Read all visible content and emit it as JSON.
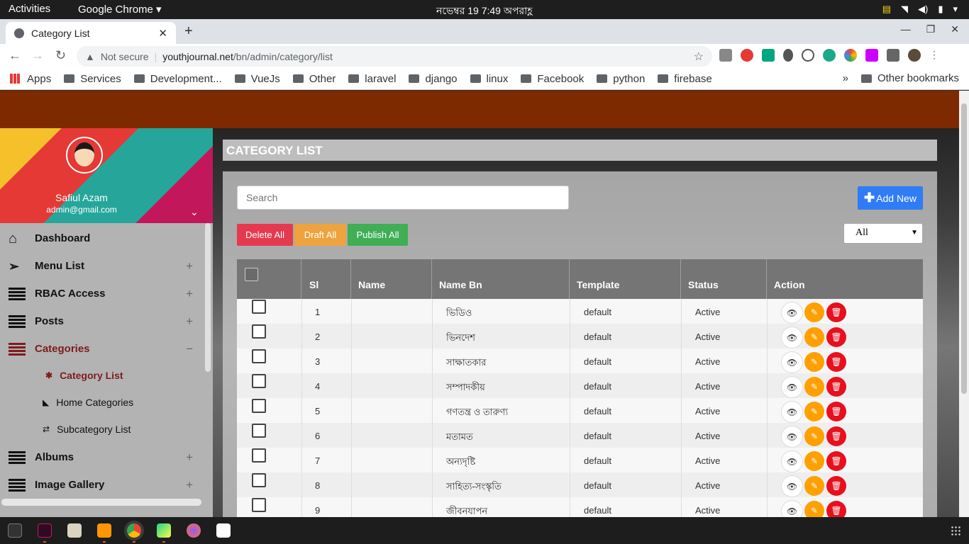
{
  "system": {
    "activities": "Activities",
    "app_menu": "Google Chrome",
    "clock": "নভেম্বর 19   7:49 অপরাহ্ণ"
  },
  "browser": {
    "tab_title": "Category List",
    "omnibox": {
      "security": "Not secure",
      "host": "youthjournal.net",
      "path": "/bn/admin/category/list"
    },
    "bookmarks": [
      "Apps",
      "Services",
      "Development...",
      "VueJs",
      "Other",
      "laravel",
      "django",
      "linux",
      "Facebook",
      "python",
      "firebase"
    ],
    "other_bookmarks": "Other bookmarks"
  },
  "sidebar": {
    "user_name": "Safiul Azam",
    "user_email": "admin@gmail.com",
    "menu": [
      {
        "label": "Dashboard",
        "icon": "home-icon"
      },
      {
        "label": "Menu List",
        "icon": "paper-plane-icon"
      },
      {
        "label": "RBAC Access",
        "icon": "bars-icon"
      },
      {
        "label": "Posts",
        "icon": "bars-icon"
      },
      {
        "label": "Categories",
        "icon": "bars-icon"
      },
      {
        "label": "Albums",
        "icon": "bars-icon"
      },
      {
        "label": "Image Gallery",
        "icon": "bars-icon"
      }
    ],
    "submenu": [
      {
        "label": "Category List",
        "icon": "asterisk-icon"
      },
      {
        "label": "Home Categories",
        "icon": "tag-icon"
      },
      {
        "label": "Subcategory List",
        "icon": "exchange-icon"
      }
    ]
  },
  "main": {
    "title": "CATEGORY LIST",
    "search_placeholder": "Search",
    "add_new": "Add New",
    "delete_all": "Delete All",
    "draft_all": "Draft All",
    "publish_all": "Publish All",
    "filter_selected": "All",
    "columns": [
      "Sl",
      "Name",
      "Name Bn",
      "Template",
      "Status",
      "Action"
    ],
    "rows": [
      {
        "sl": "1",
        "name": "",
        "name_bn": "ভিডিও",
        "template": "default",
        "status": "Active"
      },
      {
        "sl": "2",
        "name": "",
        "name_bn": "ভিনদেশ",
        "template": "default",
        "status": "Active"
      },
      {
        "sl": "3",
        "name": "",
        "name_bn": "সাক্ষাতকার",
        "template": "default",
        "status": "Active"
      },
      {
        "sl": "4",
        "name": "",
        "name_bn": "সম্পাদকীয়",
        "template": "default",
        "status": "Active"
      },
      {
        "sl": "5",
        "name": "",
        "name_bn": "গণতন্ত্র ও তারুণ্য",
        "template": "default",
        "status": "Active"
      },
      {
        "sl": "6",
        "name": "",
        "name_bn": "মতামত",
        "template": "default",
        "status": "Active"
      },
      {
        "sl": "7",
        "name": "",
        "name_bn": "অন্যদৃষ্টি",
        "template": "default",
        "status": "Active"
      },
      {
        "sl": "8",
        "name": "",
        "name_bn": "সাহিত্য-সংস্কৃতি",
        "template": "default",
        "status": "Active"
      },
      {
        "sl": "9",
        "name": "",
        "name_bn": "জীবনযাপন",
        "template": "default",
        "status": "Active"
      }
    ]
  },
  "colors": {
    "header_brown": "#7e2a00",
    "active_menu": "#7e1c1c",
    "add_new_blue": "#2f7cf6",
    "delete_red": "#e53950",
    "draft_orange": "#eea33e",
    "publish_green": "#3fae55"
  }
}
